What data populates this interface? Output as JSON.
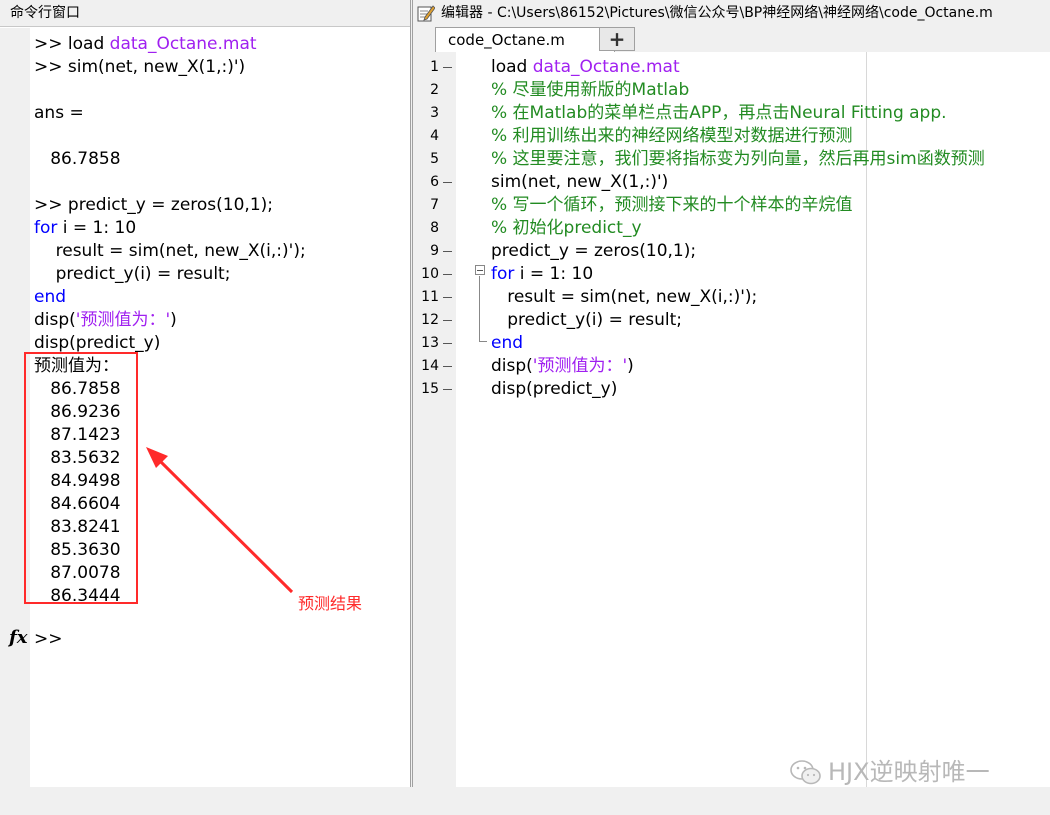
{
  "command_window": {
    "title": "命令行窗口",
    "lines": [
      {
        "prompt": ">> ",
        "kw": "",
        "text": "load ",
        "str": "data_Octane.mat",
        "tail": ""
      },
      {
        "prompt": ">> ",
        "kw": "",
        "text": "sim(net, new_X(1,:)')",
        "str": "",
        "tail": ""
      },
      {
        "prompt": "",
        "kw": "",
        "text": "",
        "str": "",
        "tail": ""
      },
      {
        "prompt": "",
        "kw": "",
        "text": "ans =",
        "str": "",
        "tail": ""
      },
      {
        "prompt": "",
        "kw": "",
        "text": "",
        "str": "",
        "tail": ""
      },
      {
        "prompt": "",
        "kw": "",
        "text": "   86.7858",
        "str": "",
        "tail": ""
      },
      {
        "prompt": "",
        "kw": "",
        "text": "",
        "str": "",
        "tail": ""
      },
      {
        "prompt": ">> ",
        "kw": "",
        "text": "predict_y = zeros(10,1);",
        "str": "",
        "tail": ""
      },
      {
        "prompt": "",
        "kw": "for",
        "text": " i = 1: 10",
        "str": "",
        "tail": ""
      },
      {
        "prompt": "",
        "kw": "",
        "text": "    result = sim(net, new_X(i,:)');",
        "str": "",
        "tail": ""
      },
      {
        "prompt": "",
        "kw": "",
        "text": "    predict_y(i) = result;",
        "str": "",
        "tail": ""
      },
      {
        "prompt": "",
        "kw": "end",
        "text": "",
        "str": "",
        "tail": ""
      },
      {
        "prompt": "",
        "kw": "",
        "text": "disp(",
        "str": "'预测值为：'",
        "tail": ")"
      },
      {
        "prompt": "",
        "kw": "",
        "text": "disp(predict_y)",
        "str": "",
        "tail": ""
      },
      {
        "prompt": "",
        "kw": "",
        "text": "预测值为：",
        "str": "",
        "tail": ""
      },
      {
        "prompt": "",
        "kw": "",
        "text": "   86.7858",
        "str": "",
        "tail": ""
      },
      {
        "prompt": "",
        "kw": "",
        "text": "   86.9236",
        "str": "",
        "tail": ""
      },
      {
        "prompt": "",
        "kw": "",
        "text": "   87.1423",
        "str": "",
        "tail": ""
      },
      {
        "prompt": "",
        "kw": "",
        "text": "   83.5632",
        "str": "",
        "tail": ""
      },
      {
        "prompt": "",
        "kw": "",
        "text": "   84.9498",
        "str": "",
        "tail": ""
      },
      {
        "prompt": "",
        "kw": "",
        "text": "   84.6604",
        "str": "",
        "tail": ""
      },
      {
        "prompt": "",
        "kw": "",
        "text": "   83.8241",
        "str": "",
        "tail": ""
      },
      {
        "prompt": "",
        "kw": "",
        "text": "   85.3630",
        "str": "",
        "tail": ""
      },
      {
        "prompt": "",
        "kw": "",
        "text": "   87.0078",
        "str": "",
        "tail": ""
      },
      {
        "prompt": "",
        "kw": "",
        "text": "   86.3444",
        "str": "",
        "tail": ""
      }
    ],
    "current_prompt": ">>",
    "annotation": "预测结果",
    "annotation_color": "#ff2a2a"
  },
  "editor": {
    "title": "编辑器 - C:\\Users\\86152\\Pictures\\微信公众号\\BP神经网络\\神经网络\\code_Octane.m",
    "tab_label": "code_Octane.m",
    "tab_close": "✕",
    "tab_add": "+",
    "lines": [
      {
        "num": "1",
        "dash": true,
        "indent": "",
        "kw": "",
        "text": "load ",
        "str": "data_Octane.mat",
        "tail": "",
        "cmt": ""
      },
      {
        "num": "2",
        "dash": false,
        "indent": "",
        "kw": "",
        "text": "",
        "str": "",
        "tail": "",
        "cmt": "% 尽量使用新版的Matlab"
      },
      {
        "num": "3",
        "dash": false,
        "indent": "",
        "kw": "",
        "text": "",
        "str": "",
        "tail": "",
        "cmt": "% 在Matlab的菜单栏点击APP，再点击Neural Fitting app."
      },
      {
        "num": "4",
        "dash": false,
        "indent": "",
        "kw": "",
        "text": "",
        "str": "",
        "tail": "",
        "cmt": "% 利用训练出来的神经网络模型对数据进行预测"
      },
      {
        "num": "5",
        "dash": false,
        "indent": "",
        "kw": "",
        "text": "",
        "str": "",
        "tail": "",
        "cmt": "% 这里要注意，我们要将指标变为列向量，然后再用sim函数预测"
      },
      {
        "num": "6",
        "dash": true,
        "indent": "",
        "kw": "",
        "text": "sim(net, new_X(1,:)')",
        "str": "",
        "tail": "",
        "cmt": ""
      },
      {
        "num": "7",
        "dash": false,
        "indent": "",
        "kw": "",
        "text": "",
        "str": "",
        "tail": "",
        "cmt": "% 写一个循环，预测接下来的十个样本的辛烷值"
      },
      {
        "num": "8",
        "dash": false,
        "indent": "",
        "kw": "",
        "text": "",
        "str": "",
        "tail": "",
        "cmt": "% 初始化predict_y"
      },
      {
        "num": "9",
        "dash": true,
        "indent": "",
        "kw": "",
        "text": "predict_y = zeros(10,1);",
        "str": "",
        "tail": "",
        "cmt": ""
      },
      {
        "num": "10",
        "dash": true,
        "indent": "",
        "kw": "for",
        "text": " i = 1: 10",
        "str": "",
        "tail": "",
        "cmt": ""
      },
      {
        "num": "11",
        "dash": true,
        "indent": "   ",
        "kw": "",
        "text": "result = sim(net, new_X(i,:)');",
        "str": "",
        "tail": "",
        "cmt": ""
      },
      {
        "num": "12",
        "dash": true,
        "indent": "   ",
        "kw": "",
        "text": "predict_y(i) = result;",
        "str": "",
        "tail": "",
        "cmt": ""
      },
      {
        "num": "13",
        "dash": true,
        "indent": "",
        "kw": "end",
        "text": "",
        "str": "",
        "tail": "",
        "cmt": ""
      },
      {
        "num": "14",
        "dash": true,
        "indent": "",
        "kw": "",
        "text": "disp(",
        "str": "'预测值为：'",
        "tail": ")",
        "cmt": ""
      },
      {
        "num": "15",
        "dash": true,
        "indent": "",
        "kw": "",
        "text": "disp(predict_y)",
        "str": "",
        "tail": "",
        "cmt": ""
      }
    ]
  },
  "watermark": {
    "text": "HJX逆映射唯一",
    "icon": "wechat-icon"
  },
  "colors": {
    "keyword": "#0000ff",
    "string": "#a020f0",
    "comment": "#228b22"
  }
}
